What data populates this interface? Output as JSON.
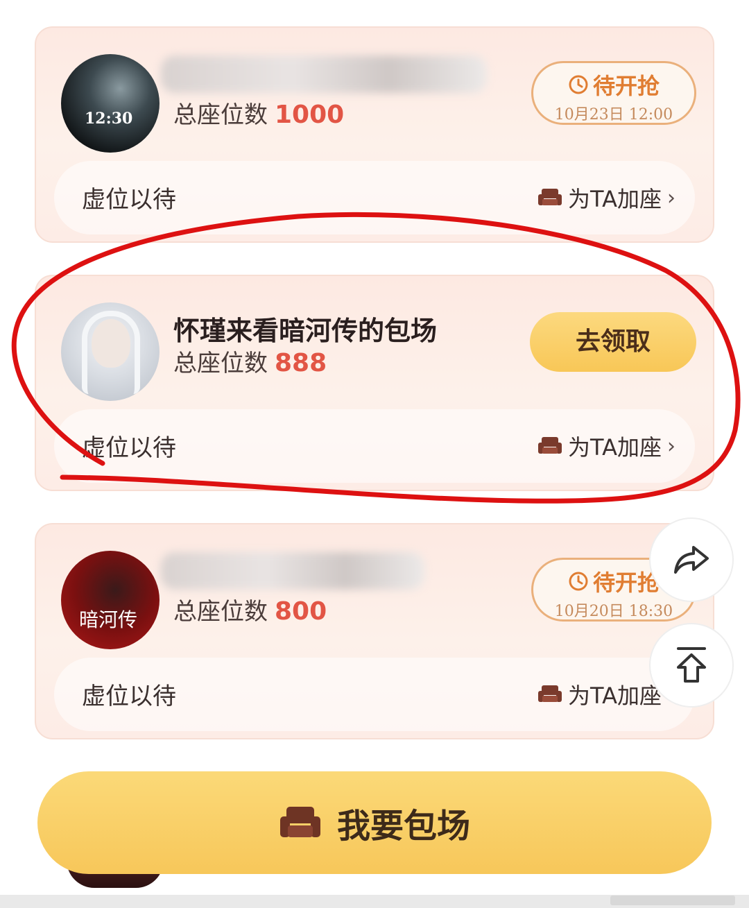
{
  "cards": [
    {
      "title": "",
      "seats_label": "总座位数",
      "seats_value": "1000",
      "status_label": "待开抢",
      "status_time": "10月23日 12:00",
      "avatar_text": "12:30",
      "row_left": "虚位以待",
      "row_right": "为TA加座"
    },
    {
      "title": "怀瑾来看暗河传的包场",
      "seats_label": "总座位数",
      "seats_value": "888",
      "action_label": "去领取",
      "row_left": "虚位以待",
      "row_right": "为TA加座"
    },
    {
      "title": "",
      "seats_label": "总座位数",
      "seats_value": "800",
      "status_label": "待开抢",
      "status_time": "10月20日 18:30",
      "avatar_text": "暗河传",
      "row_left": "虚位以待",
      "row_right": "为TA加座"
    }
  ],
  "main_button": "我要包场",
  "icons": {
    "clock": "clock-icon",
    "sofa": "sofa-icon",
    "share": "share-icon",
    "top": "back-to-top-icon"
  },
  "colors": {
    "accent_red": "#e25545",
    "accent_orange": "#e07d32",
    "button_yellow": "#f8c757",
    "annotation_red": "#dd1111"
  }
}
